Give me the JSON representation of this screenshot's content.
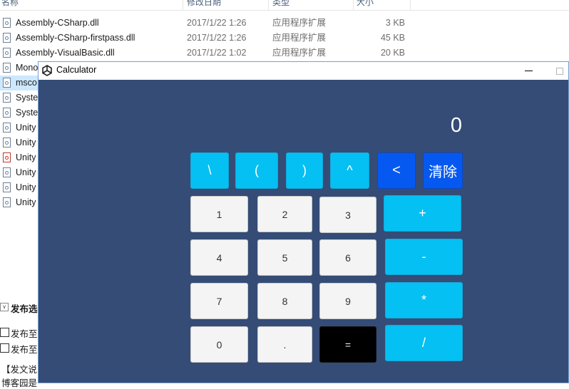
{
  "explorer": {
    "columns": [
      "名称",
      "修改日期",
      "类型",
      "大小"
    ],
    "files": [
      {
        "name": "Assembly-CSharp.dll",
        "date": "2017/1/22 1:26",
        "type": "应用程序扩展",
        "size": "3 KB",
        "icon": "dll-file-icon"
      },
      {
        "name": "Assembly-CSharp-firstpass.dll",
        "date": "2017/1/22 1:26",
        "type": "应用程序扩展",
        "size": "45 KB",
        "icon": "dll-file-icon"
      },
      {
        "name": "Assembly-VisualBasic.dll",
        "date": "2017/1/22 1:02",
        "type": "应用程序扩展",
        "size": "20 KB",
        "icon": "dll-file-icon"
      },
      {
        "name": "Mono",
        "icon": "dll-file-icon"
      },
      {
        "name": "msco",
        "icon": "dll-file-icon"
      },
      {
        "name": "Syste",
        "icon": "dll-file-icon"
      },
      {
        "name": "Syste",
        "icon": "dll-file-icon"
      },
      {
        "name": "Unity",
        "icon": "dll-file-icon"
      },
      {
        "name": "Unity",
        "icon": "dll-file-icon"
      },
      {
        "name": "Unity",
        "icon": "pdf-file-icon"
      },
      {
        "name": "Unity",
        "icon": "dll-file-icon"
      },
      {
        "name": "Unity",
        "icon": "dll-file-icon"
      },
      {
        "name": "Unity",
        "icon": "dll-file-icon"
      }
    ],
    "selected_row": 4,
    "publish_panel": {
      "title": "发布选",
      "options": [
        "发布至",
        "发布至"
      ],
      "note_lines": [
        "【发文说",
        "博客园是"
      ]
    }
  },
  "calculator": {
    "title": "Calculator",
    "display": "0",
    "keys": {
      "backslash": "\\",
      "lparen": "(",
      "rparen": ")",
      "power": "^",
      "back": "<",
      "clear": "清除",
      "one": "1",
      "two": "2",
      "three": "3",
      "four": "4",
      "five": "5",
      "six": "6",
      "seven": "7",
      "eight": "8",
      "nine": "9",
      "zero": "0",
      "dot": ".",
      "equals": "=",
      "plus": "+",
      "minus": "-",
      "multiply": "*",
      "divide": "/"
    }
  },
  "colors": {
    "calc_background": "#344c76",
    "key_cyan": "#05c0f2",
    "key_blue": "#0659f0",
    "key_light": "#f4f4f4",
    "key_black": "#000000",
    "selection": "#cce8ff"
  }
}
